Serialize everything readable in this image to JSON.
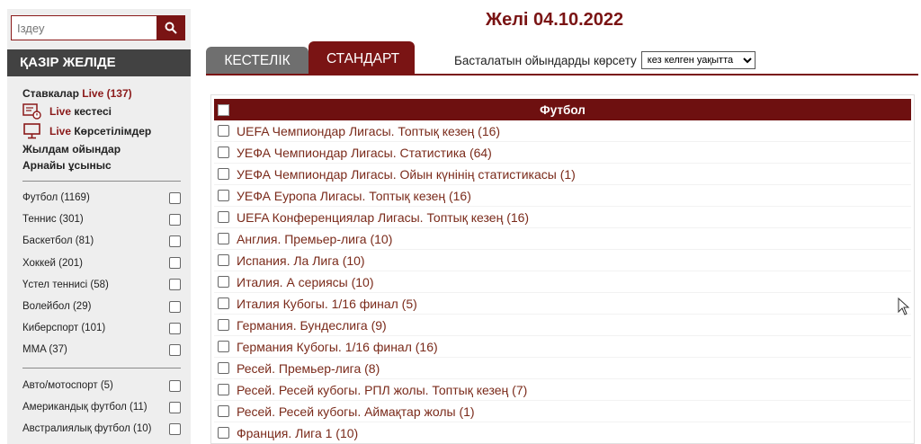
{
  "search": {
    "placeholder": "Іздеу",
    "button_icon": "search-icon"
  },
  "sidebar": {
    "header": "ҚАЗІР ЖЕЛІДЕ",
    "stakes_prefix": "Ставкалар",
    "stakes_live": "Live (137)",
    "live_schedule_live": "Live",
    "live_schedule_label": "кестесі",
    "live_broadcasts_live": "Live",
    "live_broadcasts_label": "Көрсетілімдер",
    "quick_games": "Жылдам ойындар",
    "special_offers": "Арнайы ұсыныс",
    "sports_group1": [
      {
        "label": "Футбол (1169)"
      },
      {
        "label": "Теннис (301)"
      },
      {
        "label": "Баскетбол (81)"
      },
      {
        "label": "Хоккей (201)"
      },
      {
        "label": "Үстел теннисі (58)"
      },
      {
        "label": "Волейбол (29)"
      },
      {
        "label": "Киберспорт (101)"
      },
      {
        "label": "MMA (37)"
      }
    ],
    "sports_group2": [
      {
        "label": "Авто/мотоспорт (5)"
      },
      {
        "label": "Американдық футбол (11)"
      },
      {
        "label": "Австралиялық футбол (10)"
      }
    ]
  },
  "main": {
    "title": "Желі 04.10.2022",
    "tabs": [
      {
        "label": "КЕСТЕЛІК",
        "active": false
      },
      {
        "label": "СТАНДАРТ",
        "active": true
      }
    ],
    "show_upcoming_label": "Басталатын ойындарды көрсету",
    "show_upcoming_value": "кез келген уақытта"
  },
  "table": {
    "header": "Футбол",
    "rows": [
      "UEFA Чемпиондар Лигасы. Топтық кезең (16)",
      "УЕФА Чемпиондар Лигасы. Статистика (64)",
      "УЕФА Чемпиондар Лигасы. Ойын күнінің статистикасы (1)",
      "УЕФА Еуропа Лигасы. Топтық кезең (16)",
      "UEFA Конференциялар Лигасы. Топтық кезең (16)",
      "Англия. Премьер-лига (10)",
      "Испания. Ла Лига (10)",
      "Италия. А сериясы (10)",
      "Италия Кубогы. 1/16 финал (5)",
      "Германия. Бундеслига (9)",
      "Германия Кубогы. 1/16 финал (16)",
      "Ресей. Премьер-лига (8)",
      "Ресей. Ресей кубогы. РПЛ жолы. Топтық кезең (7)",
      "Ресей. Ресей кубогы. Аймақтар жолы (1)",
      "Франция. Лига 1 (10)"
    ]
  },
  "colors": {
    "brand": "#7a1414",
    "sidebar_bg": "#eeeeee",
    "header_dark": "#424242"
  }
}
